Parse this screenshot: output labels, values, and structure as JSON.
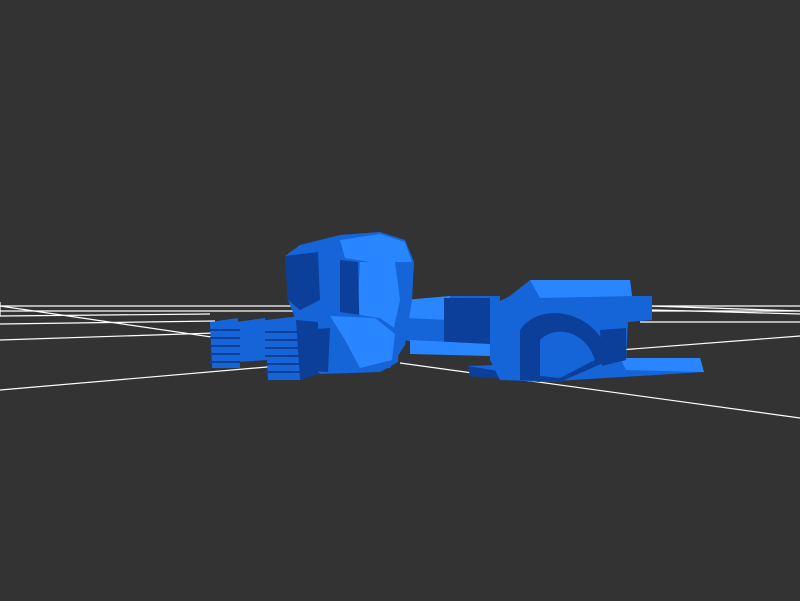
{
  "viewport": {
    "background_color": "#333333",
    "grid_color": "#ffffff",
    "model_color": "#1565d8",
    "model_highlight": "#2a86ff",
    "model_shadow": "#0b3f9a"
  },
  "scene": {
    "objects": [
      {
        "name": "ground-grid",
        "kind": "grid"
      },
      {
        "name": "robot-model",
        "kind": "mesh"
      }
    ]
  }
}
